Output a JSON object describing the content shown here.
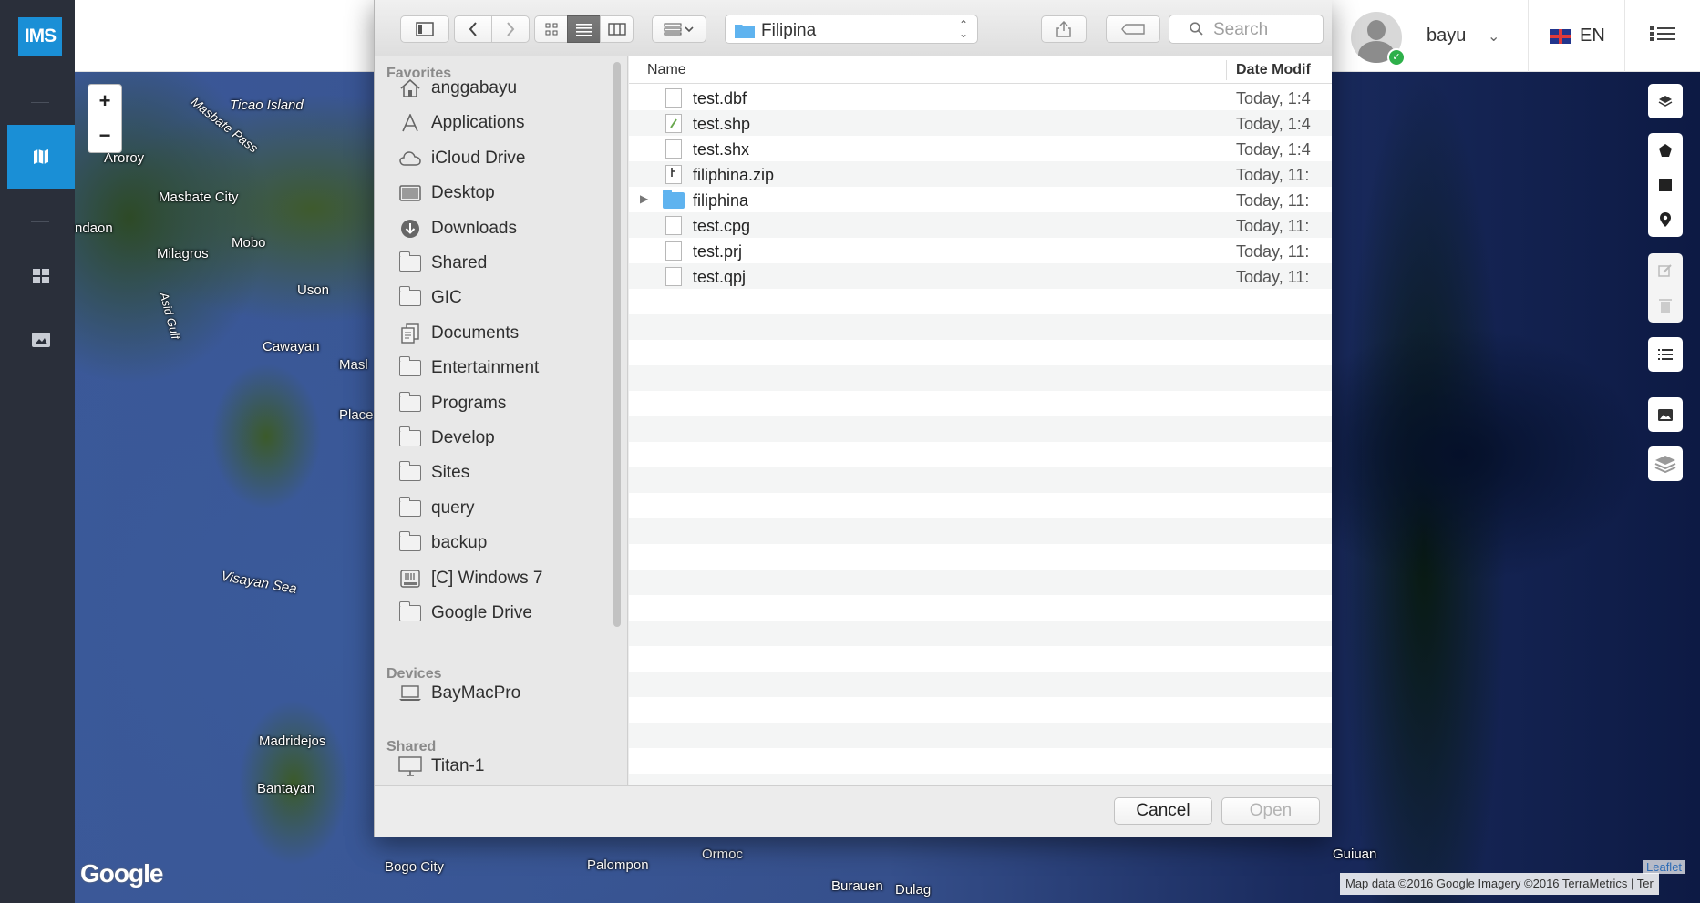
{
  "app": {
    "logo": "IMS"
  },
  "header": {
    "username": "bayu",
    "language": "EN"
  },
  "map": {
    "labels": [
      "Ticao Island",
      "Masbate Pass",
      "Aroroy",
      "Masbate City",
      "ndaon",
      "Mobo",
      "Milagros",
      "Uson",
      "Asid Gulf",
      "Cawayan",
      "Masl",
      "Place",
      "Visayan Sea",
      "Madridejos",
      "Bantayan",
      "Bogo City",
      "Palompon",
      "Ormoc",
      "Burauen",
      "Dulag",
      "Guiuan"
    ],
    "zoom_in": "+",
    "zoom_out": "−",
    "google_logo": "Google",
    "attribution": "Map data ©2016 Google Imagery ©2016 TerraMetrics | Ter",
    "leaflet": "Leaflet"
  },
  "dialog": {
    "location": "Filipina",
    "search_placeholder": "Search",
    "columns": {
      "name": "Name",
      "date": "Date Modif"
    },
    "sidebar": {
      "favorites_title": "Favorites",
      "favorites": [
        {
          "label": "anggabayu",
          "icon": "home-icon"
        },
        {
          "label": "Applications",
          "icon": "applications-icon"
        },
        {
          "label": "iCloud Drive",
          "icon": "cloud-icon"
        },
        {
          "label": "Desktop",
          "icon": "desktop-icon"
        },
        {
          "label": "Downloads",
          "icon": "downloads-icon"
        },
        {
          "label": "Shared",
          "icon": "folder-icon"
        },
        {
          "label": "GIC",
          "icon": "folder-icon"
        },
        {
          "label": "Documents",
          "icon": "documents-icon"
        },
        {
          "label": "Entertainment",
          "icon": "folder-icon"
        },
        {
          "label": "Programs",
          "icon": "folder-icon"
        },
        {
          "label": "Develop",
          "icon": "folder-icon"
        },
        {
          "label": "Sites",
          "icon": "folder-icon"
        },
        {
          "label": "query",
          "icon": "folder-icon"
        },
        {
          "label": "backup",
          "icon": "folder-icon"
        },
        {
          "label": "[C] Windows 7",
          "icon": "drive-icon"
        },
        {
          "label": "Google Drive",
          "icon": "folder-icon"
        }
      ],
      "devices_title": "Devices",
      "devices": [
        {
          "label": "BayMacPro",
          "icon": "laptop-icon"
        }
      ],
      "shared_title": "Shared",
      "shared": [
        {
          "label": "Titan-1",
          "icon": "monitor-icon"
        }
      ]
    },
    "files": [
      {
        "name": "test.dbf",
        "date": "Today, 1:4",
        "kind": "file"
      },
      {
        "name": "test.shp",
        "date": "Today, 1:4",
        "kind": "shp"
      },
      {
        "name": "test.shx",
        "date": "Today, 1:4",
        "kind": "file"
      },
      {
        "name": "filiphina.zip",
        "date": "Today, 11:",
        "kind": "zip"
      },
      {
        "name": "filiphina",
        "date": "Today, 11:",
        "kind": "folder"
      },
      {
        "name": "test.cpg",
        "date": "Today, 11:",
        "kind": "file"
      },
      {
        "name": "test.prj",
        "date": "Today, 11:",
        "kind": "file"
      },
      {
        "name": "test.qpj",
        "date": "Today, 11:",
        "kind": "file"
      }
    ],
    "cancel_label": "Cancel",
    "open_label": "Open"
  }
}
